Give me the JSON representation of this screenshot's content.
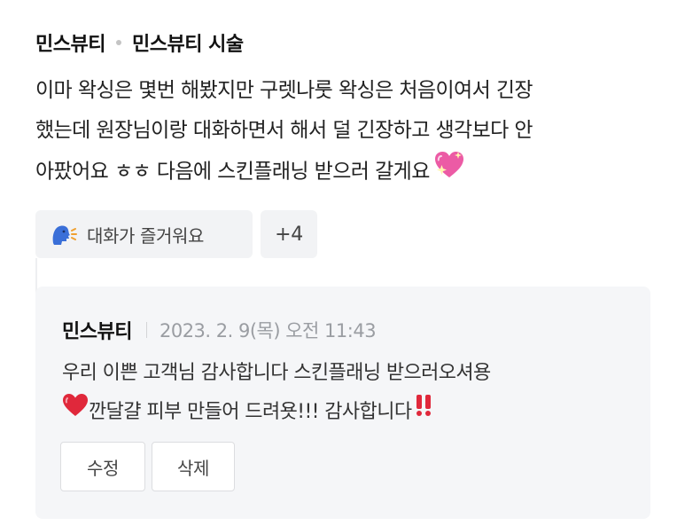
{
  "review": {
    "author": "민스뷰티",
    "category": "민스뷰티 시술",
    "lines": [
      "이마 왁싱은 몇번 해봤지만 구렛나룻 왁싱은 처음이여서 긴장",
      "했는데 원장님이랑 대화하면서 해서 덜 긴장하고 생각보다 안",
      "아팠어요 ㅎㅎ 다음에 스킨플래닝 받으러 갈게요"
    ],
    "line3_emoji": "sparkling-heart-icon"
  },
  "reactions": {
    "primary_label": "대화가 즐거워요",
    "primary_icon": "speaking-head-icon",
    "more_count": "+4"
  },
  "reply": {
    "author": "민스뷰티",
    "date": "2023. 2. 9(목) 오전 11:43",
    "line1": "우리 이쁜 고객님 감사합니다 스킨플래닝 받으러오셔용",
    "line2": "깐달걀 피부 만들어 드려욧!!! 감사합니다",
    "edit_label": "수정",
    "delete_label": "삭제"
  },
  "colors": {
    "chip_bg": "#f2f3f5",
    "reply_bg": "#f5f6f8",
    "date_gray": "#9a9da2",
    "heart_red": "#e0283b",
    "sparkle_pink": "#ec5ba5"
  }
}
